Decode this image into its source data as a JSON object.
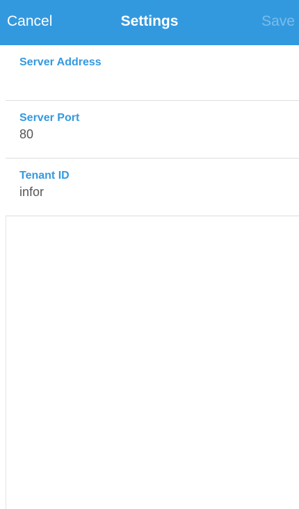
{
  "nav": {
    "cancel_label": "Cancel",
    "title": "Settings",
    "save_label": "Save"
  },
  "fields": [
    {
      "label": "Server Address",
      "value": ""
    },
    {
      "label": "Server Port",
      "value": "80"
    },
    {
      "label": "Tenant ID",
      "value": "infor"
    }
  ],
  "colors": {
    "accent": "#3399df",
    "nav_text": "#ffffff",
    "value_text": "#555555",
    "divider": "#dddddd"
  }
}
